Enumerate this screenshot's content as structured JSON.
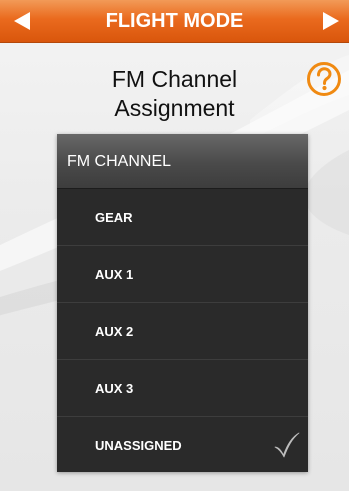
{
  "header": {
    "title": "FLIGHT MODE",
    "prev_icon": "left-arrow-icon",
    "next_icon": "right-arrow-icon"
  },
  "page": {
    "title_line1": "FM Channel",
    "title_line2": "Assignment",
    "help_icon": "question-mark-icon"
  },
  "channel_list": {
    "header_label": "FM CHANNEL",
    "items": [
      {
        "label": "GEAR",
        "selected": false
      },
      {
        "label": "AUX 1",
        "selected": false
      },
      {
        "label": "AUX 2",
        "selected": false
      },
      {
        "label": "AUX 3",
        "selected": false
      },
      {
        "label": "UNASSIGNED",
        "selected": true
      }
    ],
    "selected_icon": "checkmark-icon"
  },
  "colors": {
    "header_accent": "#ea6a1e",
    "help_icon": "#f08a12",
    "list_background": "#2a2a2a"
  }
}
